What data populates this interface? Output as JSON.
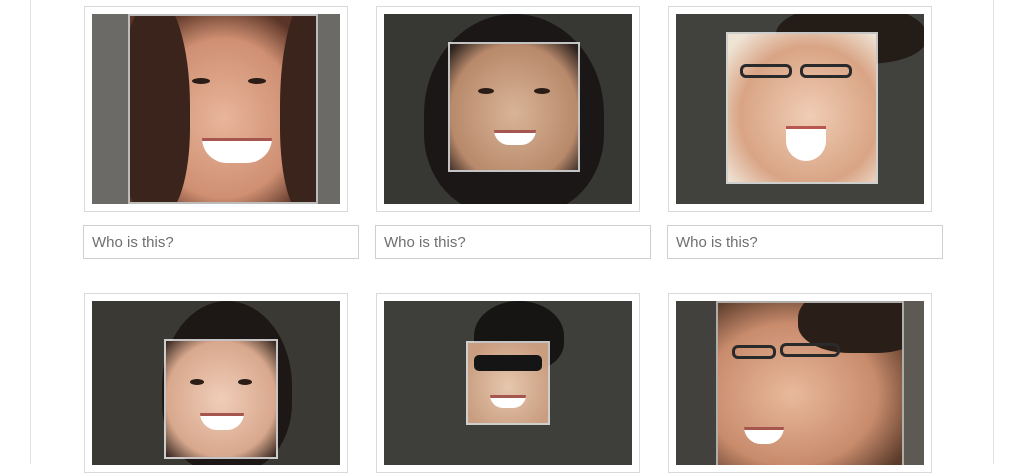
{
  "tag_prompts": [
    {
      "placeholder": "Who is this?"
    },
    {
      "placeholder": "Who is this?"
    },
    {
      "placeholder": "Who is this?"
    }
  ],
  "colors": {
    "face_box_border": "#ffffff",
    "input_border": "#cfcfcf",
    "placeholder_text": "#6f6f6f"
  }
}
